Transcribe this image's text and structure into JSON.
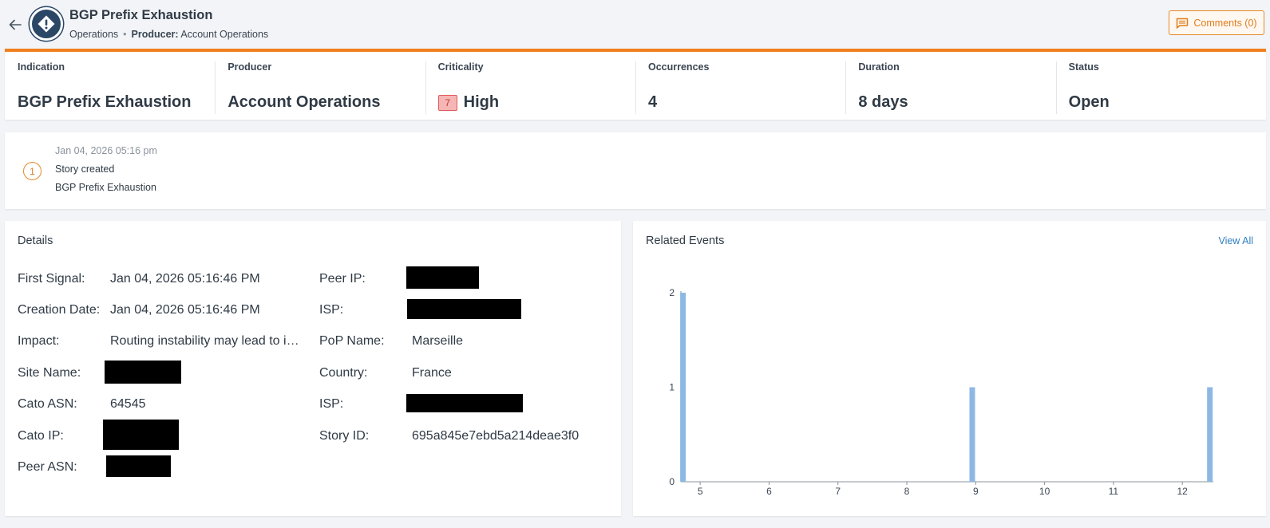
{
  "header": {
    "title": "BGP Prefix Exhaustion",
    "breadcrumb_category": "Operations",
    "producer_label": "Producer:",
    "producer_value": "Account Operations",
    "comments_label": "Comments (0)"
  },
  "summary": [
    {
      "label": "Indication",
      "value": "BGP Prefix Exhaustion"
    },
    {
      "label": "Producer",
      "value": "Account Operations"
    },
    {
      "label": "Criticality",
      "value": "High",
      "badge": "7"
    },
    {
      "label": "Occurrences",
      "value": "4"
    },
    {
      "label": "Duration",
      "value": "8 days"
    },
    {
      "label": "Status",
      "value": "Open"
    }
  ],
  "timeline": {
    "number": "1",
    "date": "Jan 04, 2026 05:16 pm",
    "event": "Story created",
    "description": "BGP Prefix Exhaustion"
  },
  "details": {
    "title": "Details",
    "left": [
      {
        "label": "First Signal:",
        "value": "Jan 04, 2026 05:16:46 PM"
      },
      {
        "label": "Creation Date:",
        "value": "Jan 04, 2026 05:16:46 PM"
      },
      {
        "label": "Impact:",
        "value": "Routing instability may lead to intermittent connectivity"
      },
      {
        "label": "Site Name:",
        "value": ""
      },
      {
        "label": "Cato ASN:",
        "value": "64545"
      },
      {
        "label": "Cato IP:",
        "value": ""
      },
      {
        "label": "Peer ASN:",
        "value": ""
      }
    ],
    "right": [
      {
        "label": "Peer IP:",
        "value": ""
      },
      {
        "label": "ISP:",
        "value": ""
      },
      {
        "label": "PoP Name:",
        "value": "Marseille"
      },
      {
        "label": "Country:",
        "value": "France"
      },
      {
        "label": "ISP:",
        "value": ""
      },
      {
        "label": "Story ID:",
        "value": "695a845e7ebd5a214deae3f0"
      }
    ]
  },
  "related_events": {
    "title": "Related Events",
    "view_all_label": "View All"
  },
  "chart_data": {
    "type": "bar",
    "title": "",
    "xlabel": "",
    "ylabel": "",
    "x": [
      4.75,
      8.95,
      12.4
    ],
    "values": [
      2,
      1,
      1
    ],
    "xlim": [
      4.72,
      12.45
    ],
    "ylim": [
      0,
      2
    ],
    "xticks": [
      5,
      6,
      7,
      8,
      9,
      10,
      11,
      12
    ],
    "yticks": [
      0,
      1,
      2
    ],
    "bar_color": "#8db8e4",
    "grid": false
  },
  "colors": {
    "accent": "#f0801e",
    "link": "#2f7fc1",
    "criticality_badge": "#f7b6b6",
    "icon_bg": "#2b4766"
  }
}
